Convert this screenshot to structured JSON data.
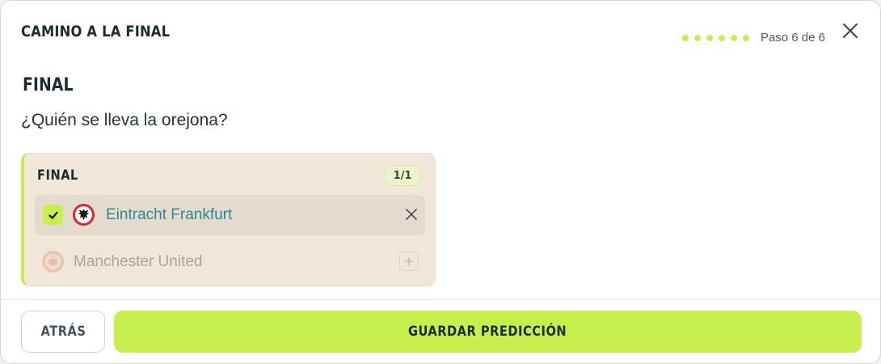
{
  "header": {
    "title": "CAMINO A LA FINAL",
    "step_text": "Paso 6 de 6",
    "steps_total": 6,
    "steps_done": 6,
    "close_icon": "close-icon"
  },
  "section": {
    "title": "FINAL",
    "question": "¿Quién se lleva la orejona?"
  },
  "card": {
    "title": "FINAL",
    "count_badge": "1/1",
    "selected_team": {
      "name": "Eintracht Frankfurt",
      "selected": true,
      "icon": "eintracht-frankfurt-crest-icon"
    },
    "other_team": {
      "name": "Manchester United",
      "selected": false,
      "icon": "manchester-united-crest-icon"
    }
  },
  "footer": {
    "back_label": "ATRÁS",
    "save_label": "GUARDAR PREDICCIÓN"
  },
  "colors": {
    "accent": "#c6ef4e",
    "accent_light": "#e7f4b8",
    "card_bg": "#f1e7d8",
    "selected_row_bg": "#e4dace",
    "selected_team_text": "#2e8a96",
    "muted_team_text": "#a9a69f",
    "text_dark": "#1d2b33",
    "frankfurt_red": "#d7262e"
  }
}
